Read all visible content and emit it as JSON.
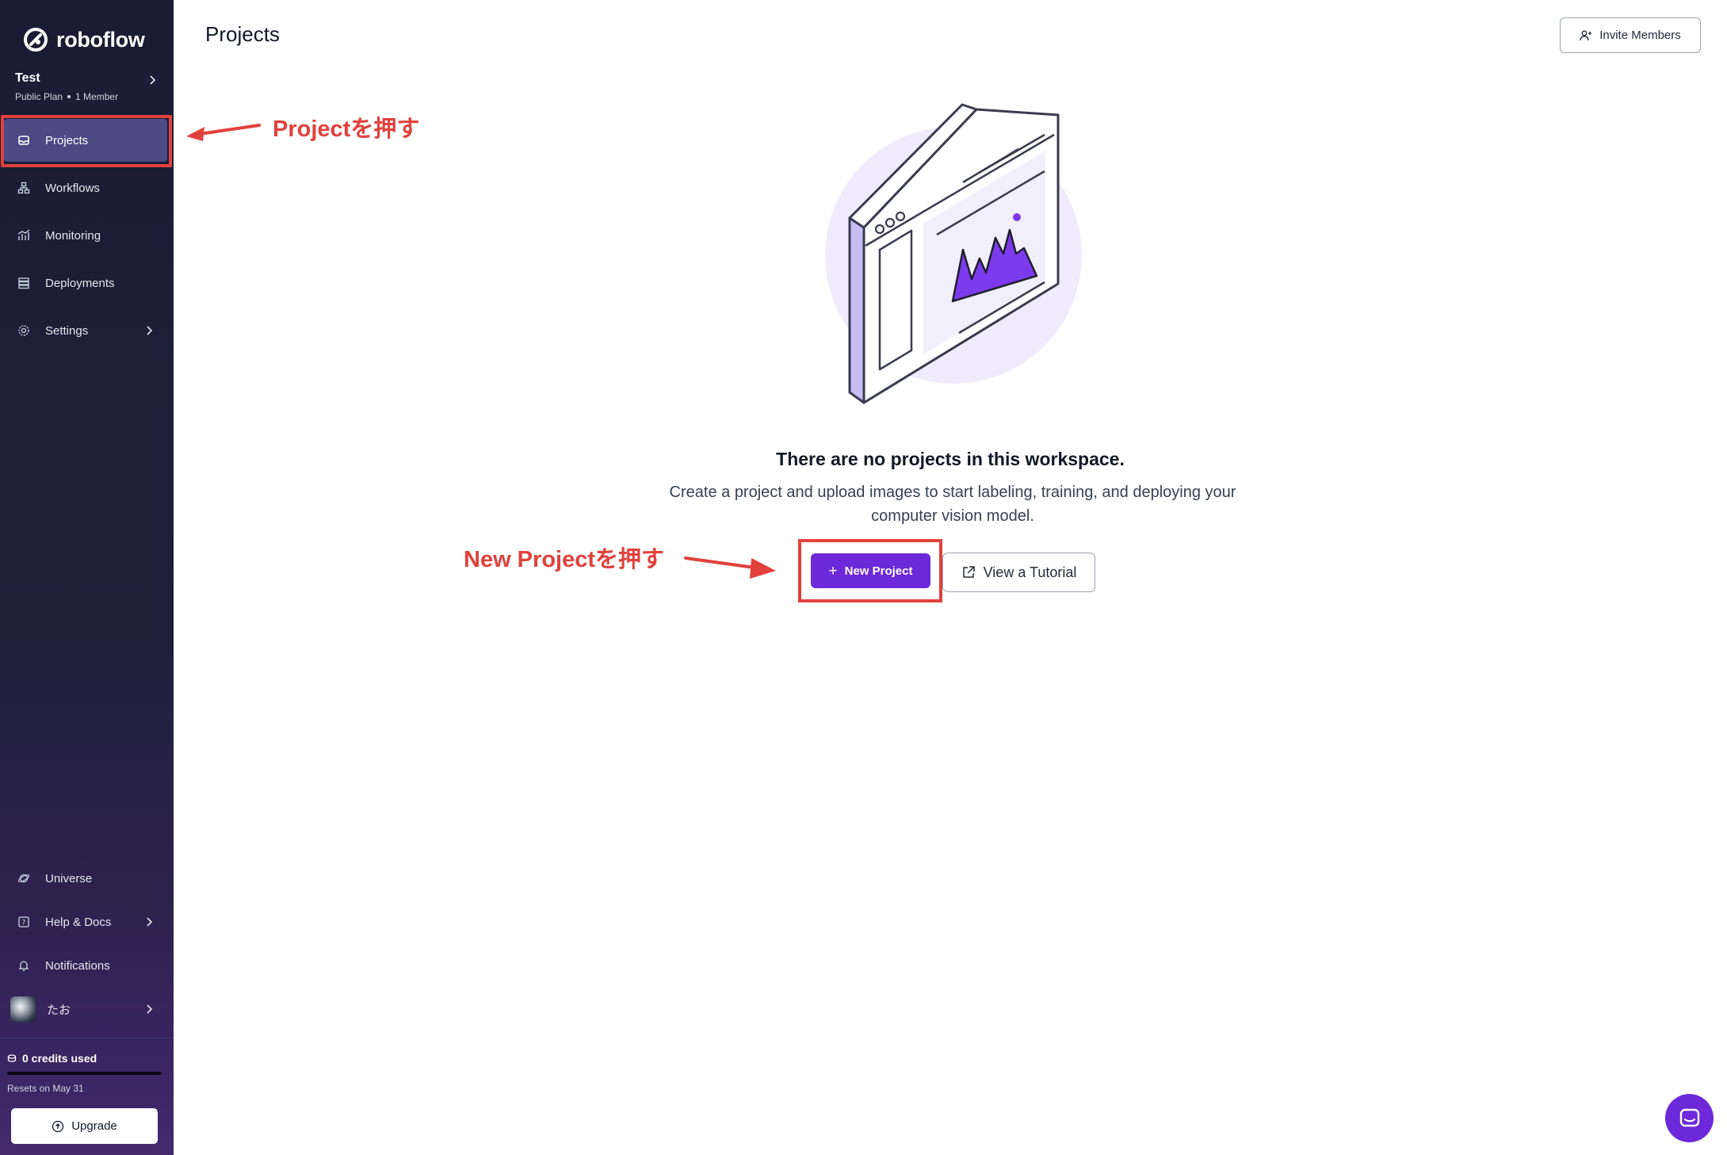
{
  "brand": {
    "name": "roboflow"
  },
  "workspace": {
    "name": "Test",
    "plan": "Public Plan",
    "members": "1 Member"
  },
  "nav": {
    "projects": "Projects",
    "workflows": "Workflows",
    "monitoring": "Monitoring",
    "deployments": "Deployments",
    "settings": "Settings"
  },
  "bottom_nav": {
    "universe": "Universe",
    "help": "Help & Docs",
    "notifications": "Notifications",
    "user": "たお"
  },
  "credits": {
    "used_label": "0 credits used",
    "used_fraction": 0,
    "resets": "Resets on May 31",
    "upgrade": "Upgrade"
  },
  "header": {
    "title": "Projects",
    "invite": "Invite Members"
  },
  "empty_state": {
    "title": "There are no projects in this workspace.",
    "description": "Create a project and upload images to start labeling, training, and deploying your computer vision model.",
    "new_project": "New Project",
    "tutorial": "View a Tutorial"
  },
  "annotations": {
    "projects_hint": "Projectを押す",
    "new_project_hint": "New Projectを押す"
  },
  "colors": {
    "accent": "#6d28d9",
    "annotation": "#e0413c",
    "sidebar_bg": "#1b1c33"
  }
}
